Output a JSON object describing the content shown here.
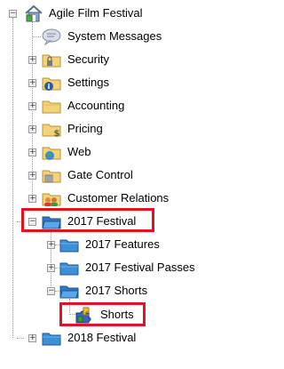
{
  "tree": {
    "root": {
      "label": "Agile Film Festival",
      "expander": "−",
      "icon": "home-icon"
    },
    "items": [
      {
        "label": "System Messages",
        "icon": "chat-bubble-icon",
        "expander": ""
      },
      {
        "label": "Security",
        "icon": "folder-lock-icon",
        "expander": "+"
      },
      {
        "label": "Settings",
        "icon": "folder-info-icon",
        "expander": "+"
      },
      {
        "label": "Accounting",
        "icon": "folder-icon",
        "expander": "+"
      },
      {
        "label": "Pricing",
        "icon": "folder-price-icon",
        "expander": "+"
      },
      {
        "label": "Web",
        "icon": "folder-globe-icon",
        "expander": "+"
      },
      {
        "label": "Gate Control",
        "icon": "folder-gate-icon",
        "expander": "+"
      },
      {
        "label": "Customer Relations",
        "icon": "folder-people-icon",
        "expander": "+"
      },
      {
        "label": "2017 Festival",
        "icon": "blue-folder-open-icon",
        "expander": "−"
      },
      {
        "label": "2017 Features",
        "icon": "blue-folder-icon",
        "expander": "+"
      },
      {
        "label": "2017 Festival Passes",
        "icon": "blue-folder-icon",
        "expander": "+"
      },
      {
        "label": "2017 Shorts",
        "icon": "blue-folder-open-icon",
        "expander": "−"
      },
      {
        "label": "Shorts",
        "icon": "puzzle-icon",
        "expander": ""
      },
      {
        "label": "2018 Festival",
        "icon": "blue-folder-icon",
        "expander": "+"
      }
    ]
  },
  "colors": {
    "highlight": "#e0141e",
    "yellow_folder": "#f2d27a",
    "blue_folder": "#3d8fd6"
  }
}
